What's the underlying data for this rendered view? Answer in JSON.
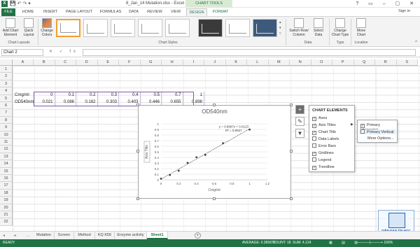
{
  "window": {
    "title": "8_Jan_14 Mutation.xlsx - Excel",
    "contextual_group": "CHART TOOLS",
    "sign_in": "Sign in"
  },
  "tabs": [
    "FILE",
    "HOME",
    "INSERT",
    "PAGE LAYOUT",
    "FORMULAS",
    "DATA",
    "REVIEW",
    "VIEW",
    "DESIGN",
    "FORMAT"
  ],
  "ribbon": {
    "add_chart_element": "Add Chart Element",
    "quick_layout": "Quick Layout",
    "change_colors": "Change Colors",
    "chart_layouts_label": "Chart Layouts",
    "chart_styles_label": "Chart Styles",
    "switch_row_column": "Switch Row/ Column",
    "select_data": "Select Data",
    "data_label": "Data",
    "change_chart_type": "Change Chart Type",
    "type_label": "Type",
    "move_chart": "Move Chart",
    "location_label": "Location"
  },
  "formula_bar": {
    "name_box": "Chart 2",
    "fx": "fx"
  },
  "columns": [
    "A",
    "B",
    "C",
    "D",
    "E",
    "F",
    "G",
    "H",
    "I",
    "J",
    "K",
    "L",
    "M",
    "N",
    "O",
    "P",
    "Q",
    "R",
    "S"
  ],
  "rows": [
    "1",
    "2",
    "3",
    "4",
    "5",
    "6",
    "7",
    "8",
    "9",
    "10",
    "11",
    "12",
    "13",
    "14",
    "15",
    "16",
    "17",
    "18",
    "19",
    "20",
    "21",
    "22"
  ],
  "sheet": {
    "row5_label": "Cmg/ml",
    "row5_values": [
      "0",
      "0.1",
      "0.2",
      "0.3",
      "0.4",
      "0.5",
      "0.7",
      "1"
    ],
    "row6_label": "OD540nm",
    "row6_values": [
      "0.021",
      "0.086",
      "0.162",
      "0.303",
      "0.403",
      "0.446",
      "0.655",
      "0.898"
    ]
  },
  "chart_data": {
    "type": "scatter",
    "title": "OD540nm",
    "xlabel": "Cmg/ml",
    "ylabel": "Axis Title",
    "x": [
      0,
      0.1,
      0.2,
      0.3,
      0.4,
      0.5,
      0.7,
      1
    ],
    "y": [
      0.021,
      0.086,
      0.162,
      0.303,
      0.403,
      0.446,
      0.655,
      0.898
    ],
    "xlim": [
      0,
      1.2
    ],
    "ylim": [
      0,
      1
    ],
    "xticks": [
      "0",
      "0.2",
      "0.4",
      "0.6",
      "0.8",
      "1",
      "1.2"
    ],
    "yticks": [
      "0",
      "0.1",
      "0.2",
      "0.3",
      "0.4",
      "0.5",
      "0.6",
      "0.7",
      "0.8",
      "0.9",
      "1"
    ],
    "trendline": {
      "slope": 0.8987,
      "intercept": 0.0123
    },
    "equation": "y = 0.8987x + 0.0123",
    "r2": "R² = 0.9947",
    "grid": true,
    "colors": {
      "marker": "#404040",
      "trend": "#404040"
    }
  },
  "chart_elements_panel": {
    "header": "CHART ELEMENTS",
    "items": [
      {
        "label": "Axes",
        "checked": true
      },
      {
        "label": "Axis Titles",
        "checked": true
      },
      {
        "label": "Chart Title",
        "checked": true
      },
      {
        "label": "Data Labels",
        "checked": false
      },
      {
        "label": "Error Bars",
        "checked": false
      },
      {
        "label": "Gridlines",
        "checked": true
      },
      {
        "label": "Legend",
        "checked": false
      },
      {
        "label": "Trendline",
        "checked": true
      }
    ]
  },
  "axis_titles_submenu": {
    "items": [
      {
        "label": "Primary Horizontal",
        "checked": true
      },
      {
        "label": "Primary Vertical",
        "checked": false
      }
    ],
    "more": "More Options..."
  },
  "sheet_tabs": [
    "Mutation",
    "Screen",
    "Method",
    "KQ K56",
    "Enzyme activity",
    "Sheet1"
  ],
  "active_sheet": "Sheet1",
  "status": {
    "ready": "READY",
    "average": "AVERAGE: 0.385875",
    "count": "COUNT: 18",
    "sum": "SUM: 4.124"
  },
  "watermark": "DIỄN ĐÀN TIN HỌC VIỆT NAM"
}
